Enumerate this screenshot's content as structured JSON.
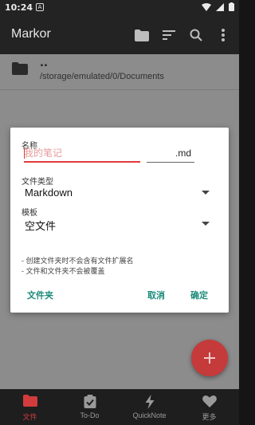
{
  "status_bar": {
    "time": "10:24",
    "notification_letter": "A"
  },
  "app_bar": {
    "title": "Markor"
  },
  "file_list": {
    "up_dir": "..",
    "path": "/storage/emulated/0/Documents"
  },
  "dialog": {
    "name_label": "名称",
    "name_placeholder": "我的笔记",
    "extension": ".md",
    "type_label": "文件类型",
    "type_value": "Markdown",
    "template_label": "模板",
    "template_value": "空文件",
    "hints": [
      "- 创建文件夹时不会含有文件扩展名",
      "- 文件和文件夹不会被覆盖"
    ],
    "folder_button": "文件夹",
    "cancel_button": "取消",
    "ok_button": "确定"
  },
  "fab": {
    "icon": "plus-icon"
  },
  "bottom_nav": [
    {
      "label": "文件",
      "icon": "folder-icon",
      "active": true
    },
    {
      "label": "To-Do",
      "icon": "todo-icon",
      "active": false
    },
    {
      "label": "QuickNote",
      "icon": "quicknote-icon",
      "active": false
    },
    {
      "label": "更多",
      "icon": "heart-icon",
      "active": false
    }
  ],
  "colors": {
    "accent": "#d23c3c",
    "button_text": "#1b8a7a",
    "app_bar": "#232323"
  }
}
